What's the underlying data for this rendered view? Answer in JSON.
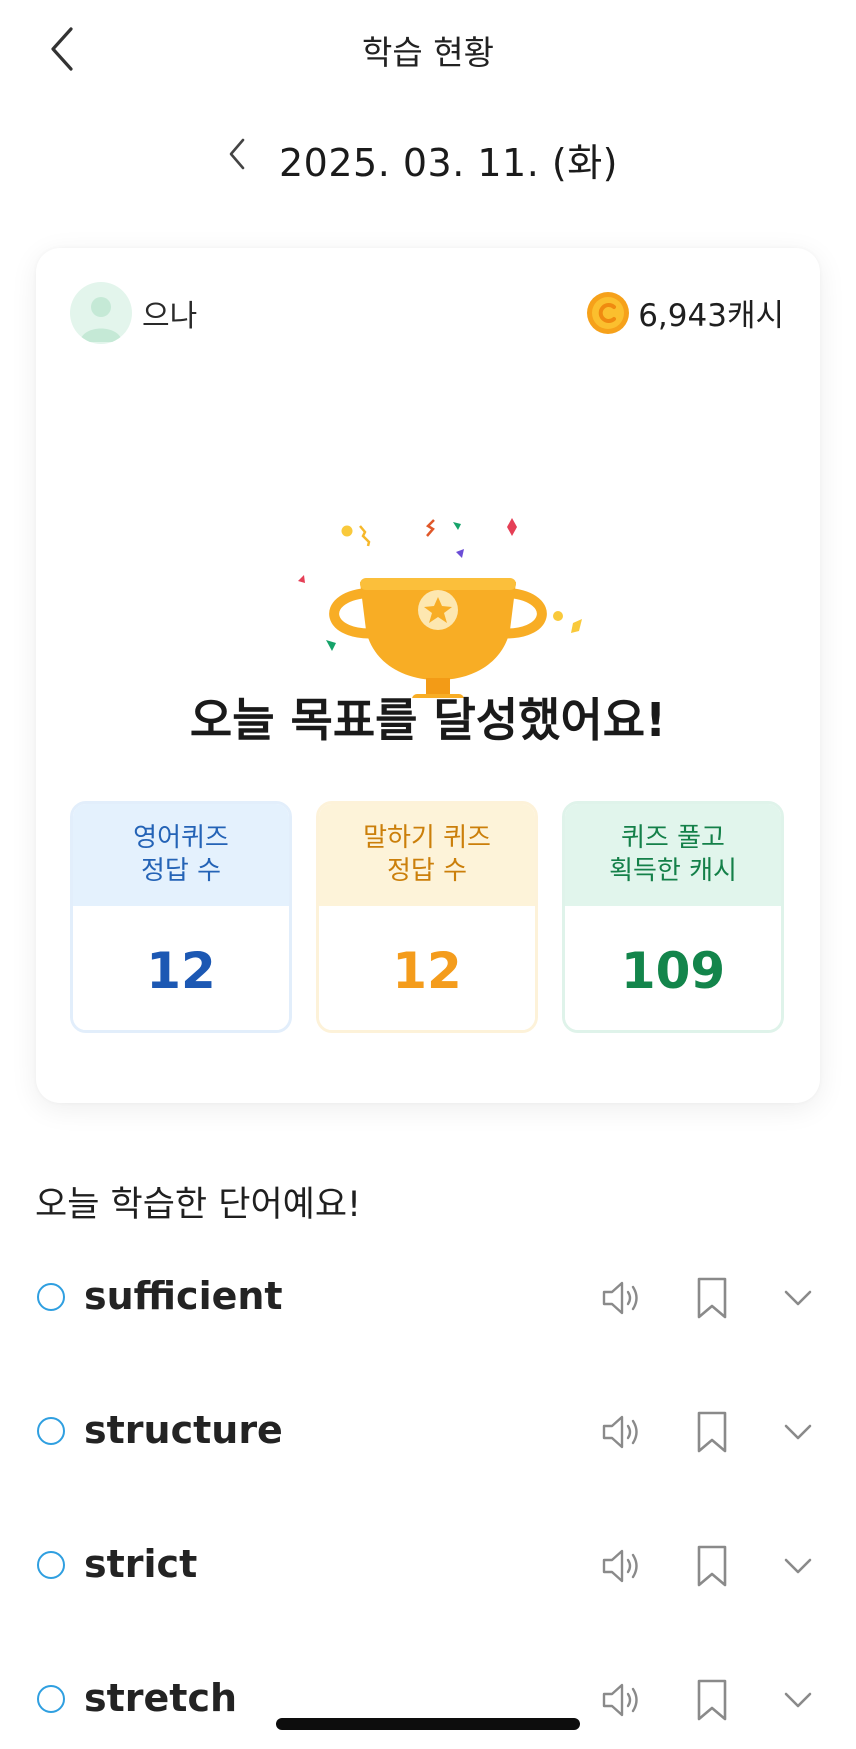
{
  "header": {
    "title": "학습 현황"
  },
  "date": {
    "label": "2025. 03. 11. (화)"
  },
  "profile": {
    "name": "으나",
    "cash": "6,943캐시"
  },
  "goal": {
    "message": "오늘 목표를 달성했어요!"
  },
  "stats": [
    {
      "line1": "영어퀴즈",
      "line2": "정답 수",
      "value": "12",
      "accent": "#1c58b3"
    },
    {
      "line1": "말하기 퀴즈",
      "line2": "정답 수",
      "value": "12",
      "accent": "#f49c1c"
    },
    {
      "line1": "퀴즈 풀고",
      "line2": "획득한 캐시",
      "value": "109",
      "accent": "#13854b"
    }
  ],
  "words_section": {
    "title": "오늘 학습한 단어예요!",
    "items": [
      {
        "word": "sufficient"
      },
      {
        "word": "structure"
      },
      {
        "word": "strict"
      },
      {
        "word": "stretch"
      }
    ]
  },
  "colors": {
    "check": "#2f9fe0",
    "trophy": "#f8ad25",
    "icon_gray": "#8a8a8a"
  }
}
